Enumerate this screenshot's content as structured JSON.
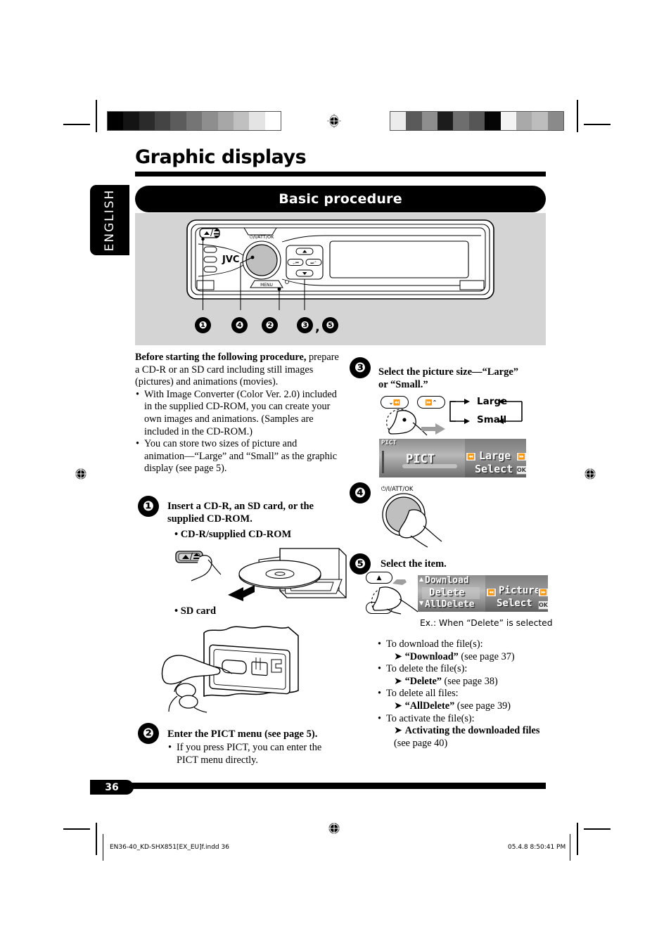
{
  "page": {
    "title": "Graphic displays",
    "language_tab": "ENGLISH",
    "section_heading": "Basic procedure",
    "page_number": "36"
  },
  "faceplate": {
    "brand": "JVC",
    "power_label": "⏻/I/ATT/OK",
    "menu_label": "MENU",
    "eject_label": "▲/⍉",
    "callouts": [
      "❶",
      "❹",
      "❷",
      "❸",
      "❺"
    ],
    "callout_separator": ","
  },
  "intro": {
    "lead_bold": "Before starting the following procedure,",
    "lead_rest": " prepare a CD-R or an SD card including still images (pictures) and animations (movies).",
    "bullets": [
      "With Image Converter (Color Ver. 2.0) included in the supplied CD-ROM, you can create your own images and animations. (Samples are included in the CD-ROM.)",
      "You can store two sizes of picture and animation—“Large” and “Small” as the graphic display (see page 5)."
    ]
  },
  "steps": {
    "one": {
      "badge": "❶",
      "title": "Insert a CD-R, an SD card, or the supplied CD-ROM.",
      "sub_cd": "• CD-R/supplied CD-ROM",
      "sub_sd": "• SD card"
    },
    "two": {
      "badge": "❷",
      "title": "Enter the PICT menu (see page 5).",
      "bullet": "If you press PICT, you can enter the PICT menu directly."
    },
    "three": {
      "badge": "❸",
      "title_line1": "Select the picture size—“Large”",
      "title_line2": "or “Small.”",
      "key_left": "⌄⏪",
      "key_right": "⏩⌃",
      "option_large": "Large",
      "option_small": "Small"
    },
    "four": {
      "badge": "❹",
      "knob_label": "⏻/I/ATT/OK"
    },
    "five": {
      "badge": "❺",
      "title": "Select the item.",
      "key_up": "▲",
      "key_down": "▼",
      "caption": "Ex.:  When “Delete” is selected",
      "bullets": [
        {
          "lead": "To download the file(s):",
          "arrow_bold": "“Download”",
          "arrow_rest": " (see page 37)"
        },
        {
          "lead": "To delete the file(s):",
          "arrow_bold": "“Delete”",
          "arrow_rest": " (see page 38)"
        },
        {
          "lead": "To delete all files:",
          "arrow_bold": "“AllDelete”",
          "arrow_rest": " (see page 39)"
        },
        {
          "lead": "To activate the file(s):",
          "arrow_bold": "Activating the downloaded files",
          "arrow_rest": " (see page 40)"
        }
      ]
    }
  },
  "lcd_pict": {
    "corner_label": "PICT",
    "main_text": "PICT",
    "value": "Large",
    "action": "Select",
    "chip_left": "⏪",
    "chip_right": "⏩",
    "chip_ok": "OK"
  },
  "lcd_menu": {
    "row1": "Download",
    "row2": "Delete",
    "row3": "AllDelete",
    "value": "Picture",
    "action": "Select",
    "chip_left": "⏪",
    "chip_right": "⏩",
    "chip_ok": "OK",
    "arrow_up": "▲",
    "arrow_down": "▼"
  },
  "footer": {
    "filename": "EN36-40_KD-SHX851[EX_EU]f.indd   36",
    "timestamp": "05.4.8   8:50:41 PM"
  },
  "colorbars": {
    "left": [
      "#000000",
      "#141414",
      "#2b2b2b",
      "#444444",
      "#5c5c5c",
      "#757575",
      "#8e8e8e",
      "#a7a7a7",
      "#c0c0c0",
      "#e4e4e4",
      "#ffffff"
    ],
    "right": [
      "#ececec",
      "#5a5a5a",
      "#8e8e8e",
      "#1c1c1c",
      "#6e6e6e",
      "#565656",
      "#050505",
      "#f4f4f4",
      "#a9a9a9",
      "#bdbdbd",
      "#8a8a8a"
    ]
  }
}
